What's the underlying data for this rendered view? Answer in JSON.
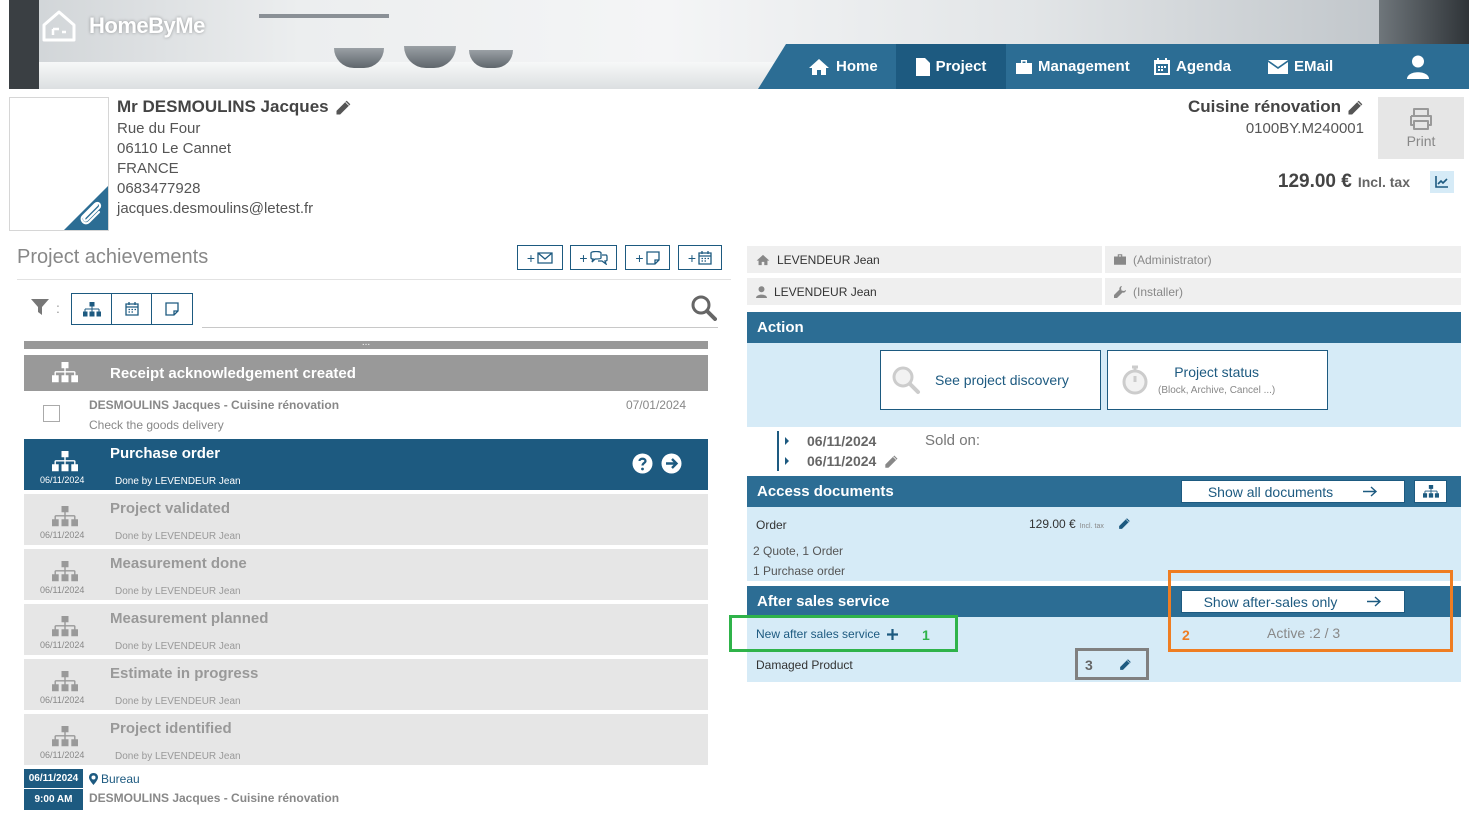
{
  "app": {
    "logo_text": "HomeByMe"
  },
  "nav": {
    "items": [
      {
        "label": "Home",
        "icon": "home-icon",
        "active": false
      },
      {
        "label": "Project",
        "icon": "document-icon",
        "active": true
      },
      {
        "label": "Management",
        "icon": "briefcase-icon",
        "active": false
      },
      {
        "label": "Agenda",
        "icon": "calendar-icon",
        "active": false
      },
      {
        "label": "EMail",
        "icon": "envelope-icon",
        "active": false
      }
    ],
    "user_icon": "user-icon"
  },
  "client": {
    "name": "Mr DESMOULINS Jacques",
    "street": "Rue du Four",
    "city": "06110 Le Cannet",
    "country": "FRANCE",
    "phone": "0683477928",
    "email": "jacques.desmoulins@letest.fr"
  },
  "project": {
    "name": "Cuisine rénovation",
    "reference": "0100BY.M240001",
    "price": "129.00 €",
    "tax_label": "Incl. tax",
    "print_label": "Print"
  },
  "achievements": {
    "title": "Project achievements",
    "quick_add_prefix": "+",
    "collapsed_marker": "...",
    "receipt_step": {
      "title": "Receipt acknowledgement created"
    },
    "receipt_task": {
      "who": "DESMOULINS Jacques - Cuisine rénovation",
      "what": "Check the goods delivery",
      "when": "07/01/2024"
    },
    "steps": [
      {
        "title": "Purchase order",
        "date": "06/11/2024",
        "done": "Done by LEVENDEUR Jean",
        "active": true
      },
      {
        "title": "Project validated",
        "date": "06/11/2024",
        "done": "Done by LEVENDEUR Jean",
        "active": false
      },
      {
        "title": "Measurement done",
        "date": "06/11/2024",
        "done": "Done by LEVENDEUR Jean",
        "active": false
      },
      {
        "title": "Measurement planned",
        "date": "06/11/2024",
        "done": "Done by LEVENDEUR Jean",
        "active": false
      },
      {
        "title": "Estimate in progress",
        "date": "06/11/2024",
        "done": "Done by LEVENDEUR Jean",
        "active": false
      },
      {
        "title": "Project identified",
        "date": "06/11/2024",
        "done": "Done by LEVENDEUR Jean",
        "active": false
      }
    ],
    "appointment": {
      "date": "06/11/2024",
      "time": "9:00 AM",
      "place": "Bureau",
      "who": "DESMOULINS Jacques - Cuisine rénovation"
    }
  },
  "people": [
    {
      "name": "LEVENDEUR Jean",
      "icon": "home-icon",
      "role": "(Administrator)",
      "role_icon": "briefcase-icon"
    },
    {
      "name": "LEVENDEUR Jean",
      "icon": "user-icon",
      "role": "(Installer)",
      "role_icon": "wrench-icon"
    }
  ],
  "action": {
    "header": "Action",
    "discovery_label": "See project discovery",
    "status_label": "Project status",
    "status_sub": "(Block, Archive, Cancel ...)"
  },
  "dates": {
    "first": "06/11/2024",
    "second": "06/11/2024",
    "sold_on": "Sold on:"
  },
  "documents": {
    "header": "Access documents",
    "show_all_label": "Show all documents",
    "order_label": "Order",
    "order_price": "129.00 €",
    "order_tax": "Incl. tax",
    "summary_1": "2 Quote, 1 Order",
    "summary_2": "1 Purchase order"
  },
  "after_sales": {
    "header": "After sales service",
    "show_only_label": "Show after-sales only",
    "new_label": "New after sales service",
    "active_label": "Active :2 / 3",
    "item_label": "Damaged Product"
  },
  "annotations": [
    {
      "number": "1",
      "color": "#2fb34a"
    },
    {
      "number": "2",
      "color": "#ef7d22"
    },
    {
      "number": "3",
      "color": "#808080"
    }
  ],
  "colors": {
    "primary": "#2c6d94",
    "primary_dark": "#1d5a80",
    "light_panel": "#d6ebf7"
  }
}
